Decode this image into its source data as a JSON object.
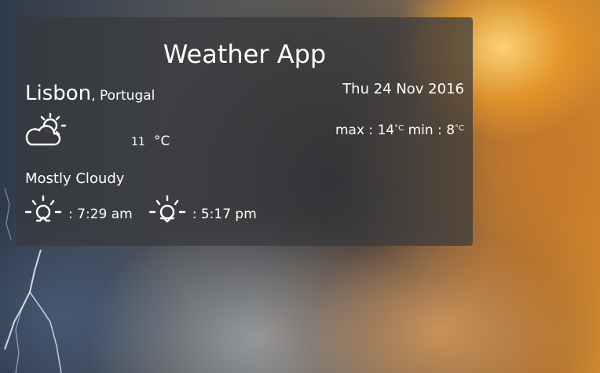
{
  "app": {
    "title": "Weather App"
  },
  "location": {
    "city": "Lisbon",
    "country": ", Portugal"
  },
  "date": "Thu 24 Nov 2016",
  "current": {
    "icon": "partly-cloudy-icon",
    "temperature": "11",
    "unit": "°C",
    "description": "Mostly Cloudy"
  },
  "forecast": {
    "max_label": "max : ",
    "max_value": "14",
    "min_label": " min : ",
    "min_value": "8",
    "unit": "°C"
  },
  "sun": {
    "sunrise_icon": "sunrise-icon",
    "sunrise": ": 7:29 am",
    "sunset_icon": "sunset-icon",
    "sunset": ": 5:17 pm"
  },
  "colors": {
    "panel": "#37393c",
    "text": "#ffffff"
  }
}
